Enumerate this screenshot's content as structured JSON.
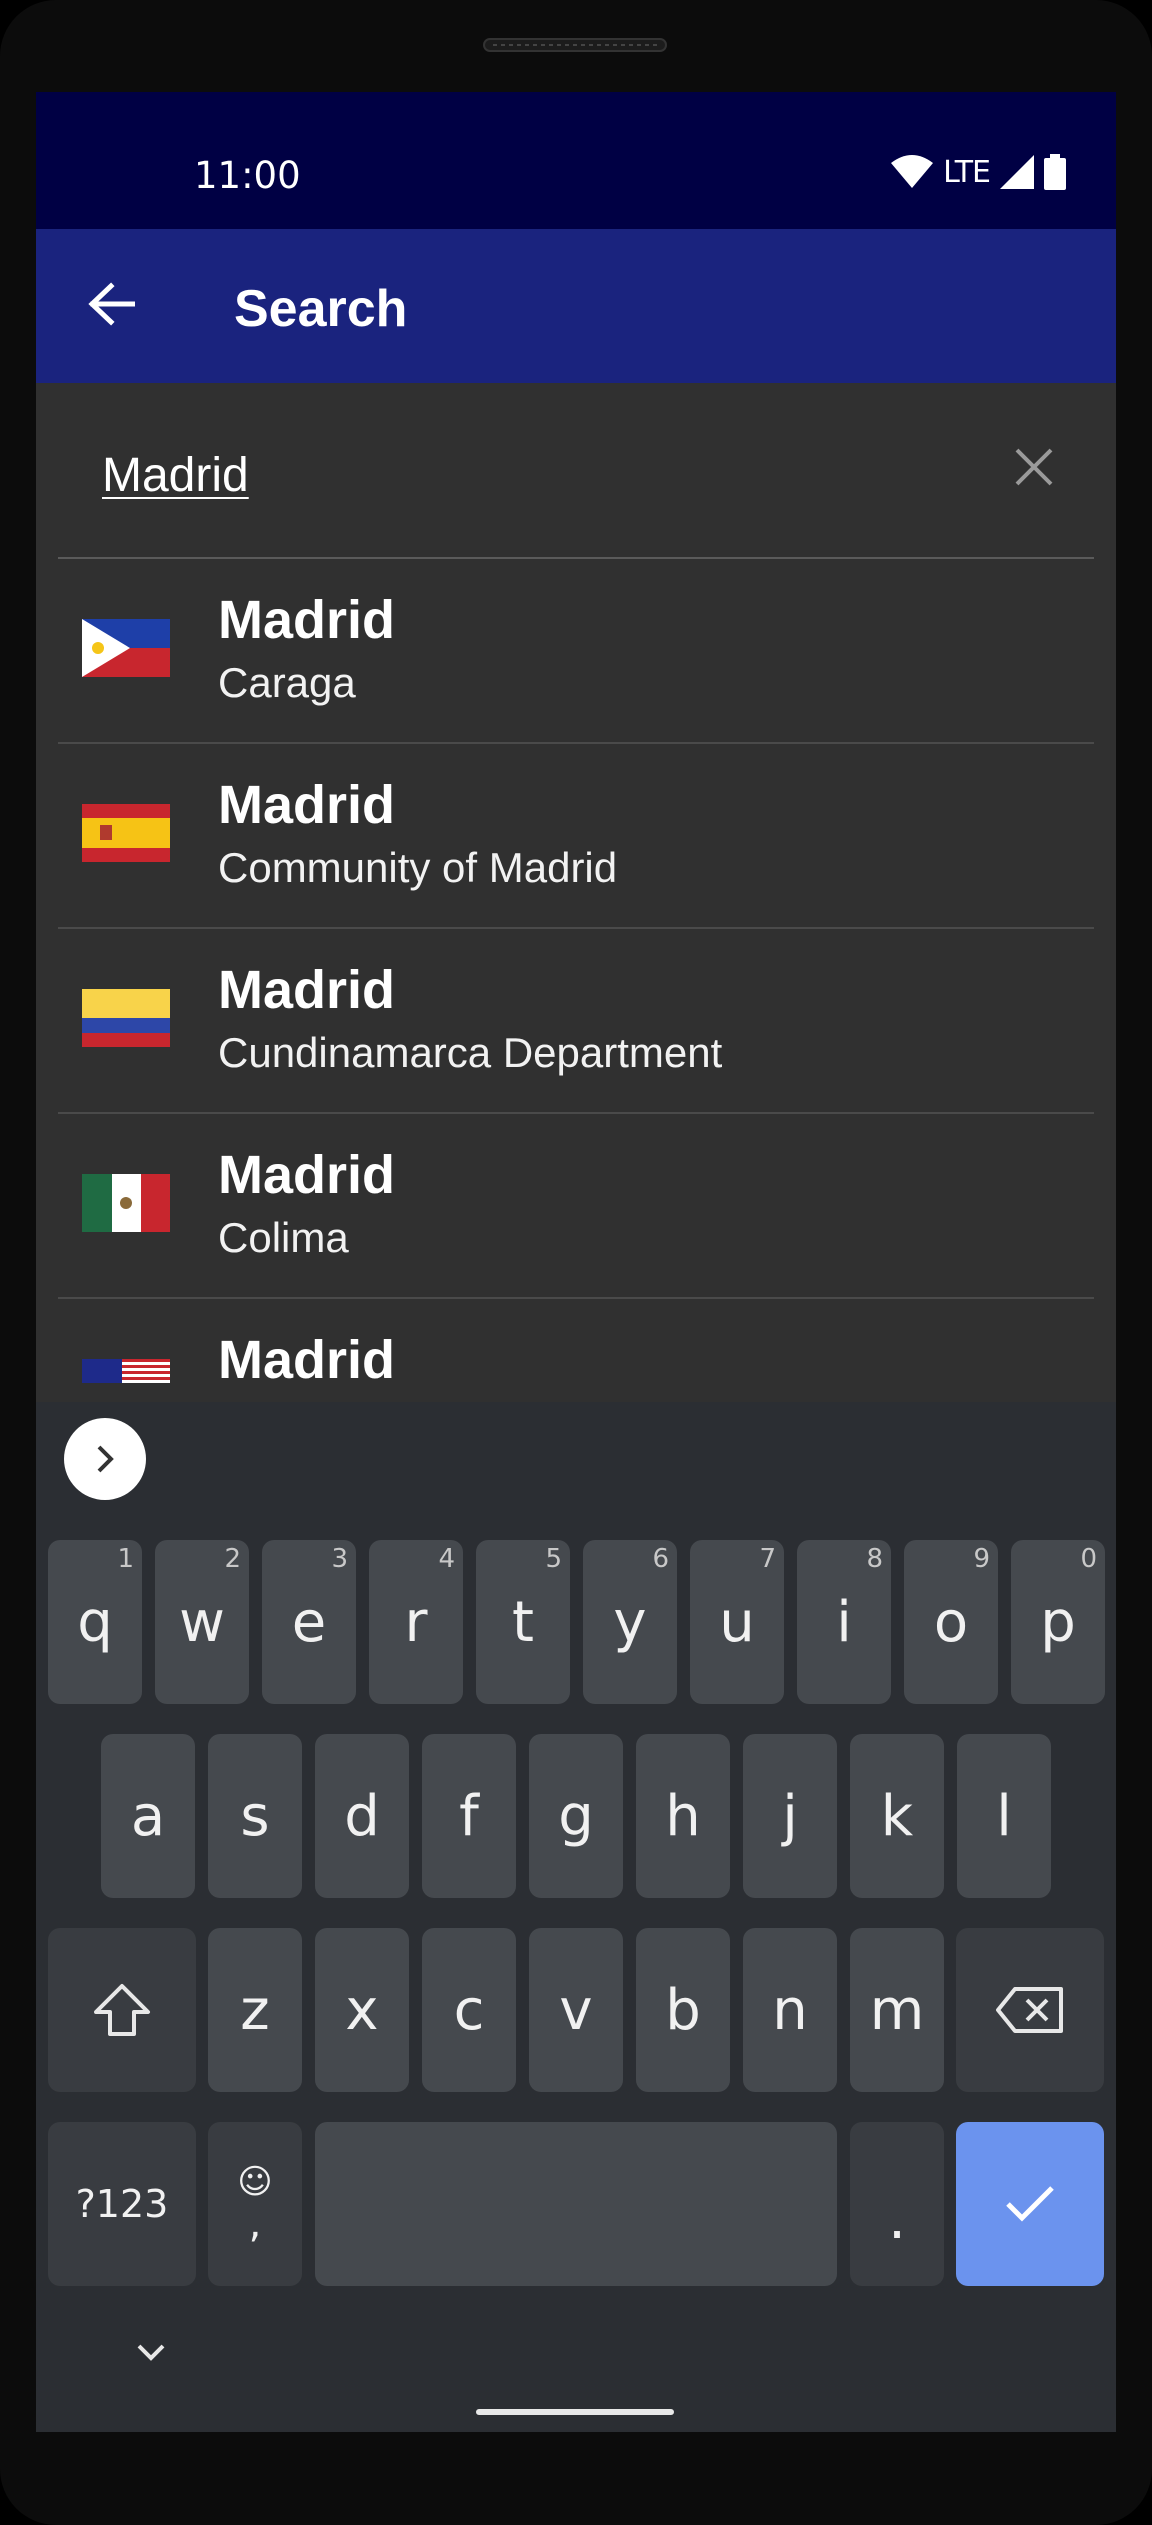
{
  "status_bar": {
    "time": "11:00",
    "network": "LTE"
  },
  "app_bar": {
    "title": "Search",
    "back_icon": "arrow-left-icon"
  },
  "search": {
    "value": "Madrid",
    "placeholder": "",
    "clear_icon": "close-icon"
  },
  "results": [
    {
      "name": "Madrid",
      "region": "Caraga",
      "flag": "philippines-flag"
    },
    {
      "name": "Madrid",
      "region": "Community of Madrid",
      "flag": "spain-flag"
    },
    {
      "name": "Madrid",
      "region": "Cundinamarca Department",
      "flag": "colombia-flag"
    },
    {
      "name": "Madrid",
      "region": "Colima",
      "flag": "mexico-flag"
    },
    {
      "name": "Madrid",
      "region": "",
      "flag": "usa-flag"
    }
  ],
  "keyboard": {
    "row1": [
      "q",
      "w",
      "e",
      "r",
      "t",
      "y",
      "u",
      "i",
      "o",
      "p"
    ],
    "row1_hints": [
      "1",
      "2",
      "3",
      "4",
      "5",
      "6",
      "7",
      "8",
      "9",
      "0"
    ],
    "row2": [
      "a",
      "s",
      "d",
      "f",
      "g",
      "h",
      "j",
      "k",
      "l"
    ],
    "row3": [
      "z",
      "x",
      "c",
      "v",
      "b",
      "n",
      "m"
    ],
    "symbols_label": "?123",
    "comma_label": ",",
    "emoji_label": "☺",
    "period_label": ".",
    "colors": {
      "background": "#2b2e33",
      "key": "#45494e",
      "fn_key": "#393c41",
      "enter": "#6b93ee"
    }
  },
  "colors": {
    "status_bar": "#000044",
    "app_bar": "#1a237e",
    "screen": "#303030"
  }
}
